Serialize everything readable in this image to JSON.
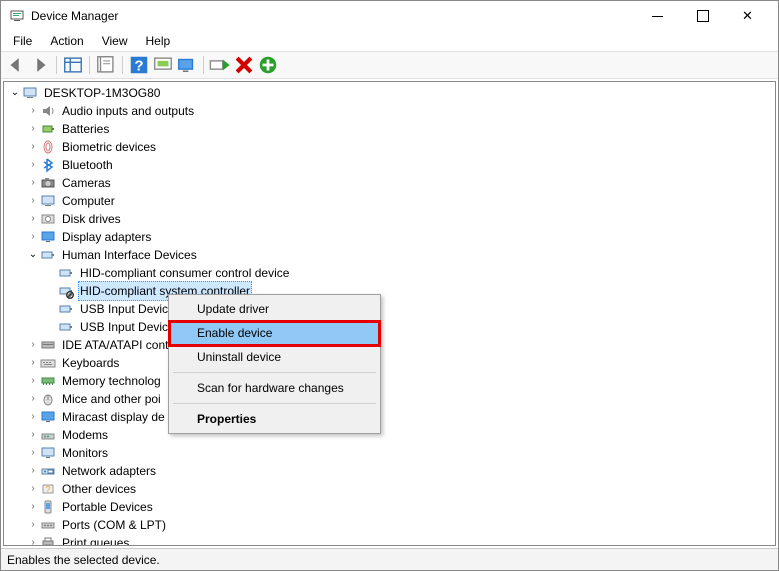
{
  "window": {
    "title": "Device Manager"
  },
  "menu": {
    "file": "File",
    "action": "Action",
    "view": "View",
    "help": "Help"
  },
  "toolbar_names": [
    "back",
    "forward",
    "show-grid",
    "properties",
    "help",
    "update",
    "scan",
    "uninstall",
    "disable",
    "enable"
  ],
  "tree": {
    "root": {
      "label": "DESKTOP-1M3OG80"
    },
    "children": [
      {
        "label": "Audio inputs and outputs",
        "icon": "audio"
      },
      {
        "label": "Batteries",
        "icon": "battery"
      },
      {
        "label": "Biometric devices",
        "icon": "finger"
      },
      {
        "label": "Bluetooth",
        "icon": "bluetooth"
      },
      {
        "label": "Cameras",
        "icon": "camera"
      },
      {
        "label": "Computer",
        "icon": "computer"
      },
      {
        "label": "Disk drives",
        "icon": "disk"
      },
      {
        "label": "Display adapters",
        "icon": "display"
      },
      {
        "label": "Human Interface Devices",
        "icon": "hid",
        "expanded": true,
        "children": [
          {
            "label": "HID-compliant consumer control device",
            "icon": "hid"
          },
          {
            "label": "HID-compliant system controller",
            "icon": "hid-disabled",
            "selected": true
          },
          {
            "label": "USB Input Devic",
            "icon": "hid",
            "truncated": true
          },
          {
            "label": "USB Input Devic",
            "icon": "hid",
            "truncated": true
          }
        ]
      },
      {
        "label": "IDE ATA/ATAPI cont",
        "icon": "ide",
        "truncated": true
      },
      {
        "label": "Keyboards",
        "icon": "keyboard"
      },
      {
        "label": "Memory technolog",
        "icon": "memory",
        "truncated": true
      },
      {
        "label": "Mice and other poi",
        "icon": "mouse",
        "truncated": true
      },
      {
        "label": "Miracast display de",
        "icon": "display",
        "truncated": true
      },
      {
        "label": "Modems",
        "icon": "modem"
      },
      {
        "label": "Monitors",
        "icon": "monitor"
      },
      {
        "label": "Network adapters",
        "icon": "network"
      },
      {
        "label": "Other devices",
        "icon": "other"
      },
      {
        "label": "Portable Devices",
        "icon": "portable"
      },
      {
        "label": "Ports (COM & LPT)",
        "icon": "port"
      },
      {
        "label": "Print queues",
        "icon": "printer",
        "cut": true
      }
    ]
  },
  "context_menu": {
    "items": [
      {
        "label": "Update driver"
      },
      {
        "label": "Enable device",
        "highlighted": true
      },
      {
        "label": "Uninstall device"
      },
      {
        "sep": true
      },
      {
        "label": "Scan for hardware changes"
      },
      {
        "sep": true
      },
      {
        "label": "Properties",
        "bold": true
      }
    ]
  },
  "status": "Enables the selected device."
}
